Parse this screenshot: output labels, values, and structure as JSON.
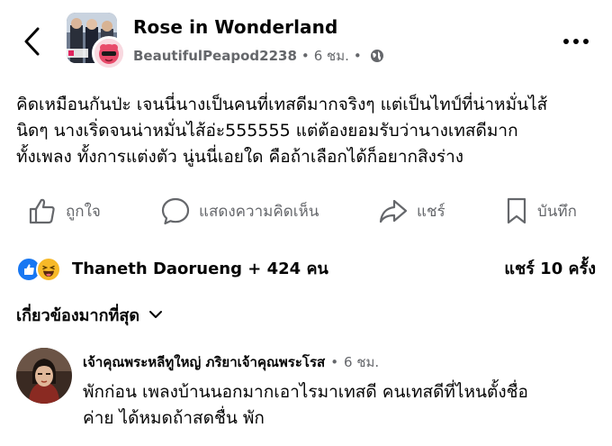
{
  "post": {
    "group_name": "Rose in Wonderland",
    "author": "BeautifulPeapod2238",
    "separator": "•",
    "time": "6 ชม.",
    "visibility_icon": "globe-icon",
    "body_lines": [
      "คิดเหมือนกันป่ะ เจนนี่นางเป็นคนที่เทสดีมากจริงๆ แต่เป็นไทป์ที่น่าหมั่นไส้",
      "นิดๆ นางเริ่ดจนน่าหมั่นไส้อ่ะ555555 แต่ต้องยอมรับว่านางเทสดีมาก",
      "ทั้งเพลง ทั้งการแต่งตัว นู่นนี่เอยใด คือถ้าเลือกได้ก็อยากสิงร่าง"
    ]
  },
  "actions": {
    "like": "ถูกใจ",
    "comment": "แสดงความคิดเห็น",
    "share": "แชร์",
    "save": "บันทึก"
  },
  "reactions": {
    "summary": "Thaneth Daorueng + 424 คน",
    "shares": "แชร์ 10 ครั้ง"
  },
  "comments": {
    "sort_label": "เกี่ยวข้องมากที่สุด",
    "items": [
      {
        "author": "เจ้าคุณพระหลีทูใหญ่ ภริยาเจ้าคุณพระโรส",
        "separator": "•",
        "time": "6 ชม.",
        "text_lines": [
          "พักก่อน เพลงบ้านนอกมากเอาไรมาเทสดี คนเทสดีที่ไหนตั้งชื่อ",
          "ค่าย ได้หมดถ้าสดชื่น พัก"
        ]
      }
    ]
  },
  "colors": {
    "secondary_text": "#65676b",
    "primary_text": "#050505",
    "like_blue": "#1877f2",
    "haha_yellow": "#f7b928"
  }
}
